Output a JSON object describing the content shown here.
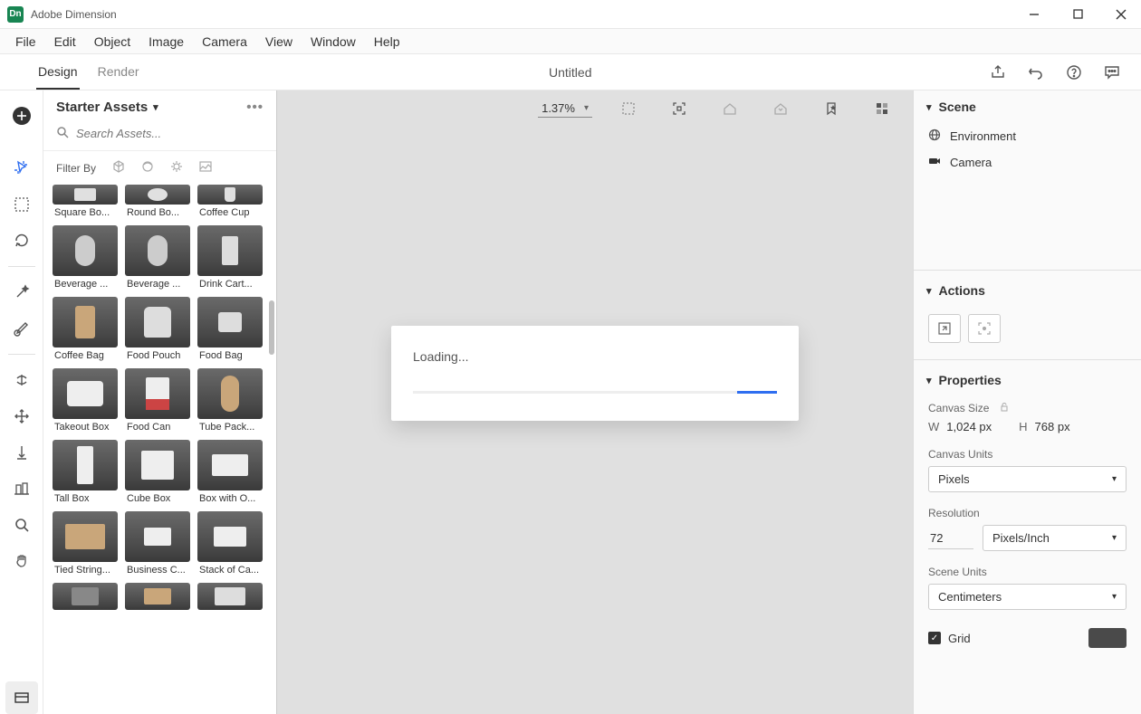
{
  "app": {
    "name": "Adobe Dimension",
    "icon_label": "Dn"
  },
  "menu": [
    "File",
    "Edit",
    "Object",
    "Image",
    "Camera",
    "View",
    "Window",
    "Help"
  ],
  "modes": {
    "design": "Design",
    "render": "Render"
  },
  "doc_title": "Untitled",
  "assets": {
    "panel_title": "Starter Assets",
    "search_placeholder": "Search Assets...",
    "filter_label": "Filter By",
    "items": [
      [
        "Square Bo...",
        "Round Bo...",
        "Coffee Cup"
      ],
      [
        "Beverage ...",
        "Beverage ...",
        "Drink Cart..."
      ],
      [
        "Coffee Bag",
        "Food Pouch",
        "Food Bag"
      ],
      [
        "Takeout Box",
        "Food Can",
        "Tube Pack..."
      ],
      [
        "Tall Box",
        "Cube Box",
        "Box with O..."
      ],
      [
        "Tied String...",
        "Business C...",
        "Stack of Ca..."
      ],
      [
        "",
        "",
        ""
      ]
    ]
  },
  "canvas": {
    "zoom": "1.37%",
    "loading_label": "Loading..."
  },
  "scene": {
    "title": "Scene",
    "items": [
      {
        "label": "Environment",
        "icon": "globe"
      },
      {
        "label": "Camera",
        "icon": "camera"
      }
    ]
  },
  "actions": {
    "title": "Actions"
  },
  "properties": {
    "title": "Properties",
    "canvas_size_label": "Canvas Size",
    "width_label": "W",
    "width_value": "1,024 px",
    "height_label": "H",
    "height_value": "768 px",
    "canvas_units_label": "Canvas Units",
    "canvas_units_value": "Pixels",
    "resolution_label": "Resolution",
    "resolution_value": "72",
    "resolution_units": "Pixels/Inch",
    "scene_units_label": "Scene Units",
    "scene_units_value": "Centimeters",
    "grid_label": "Grid"
  }
}
